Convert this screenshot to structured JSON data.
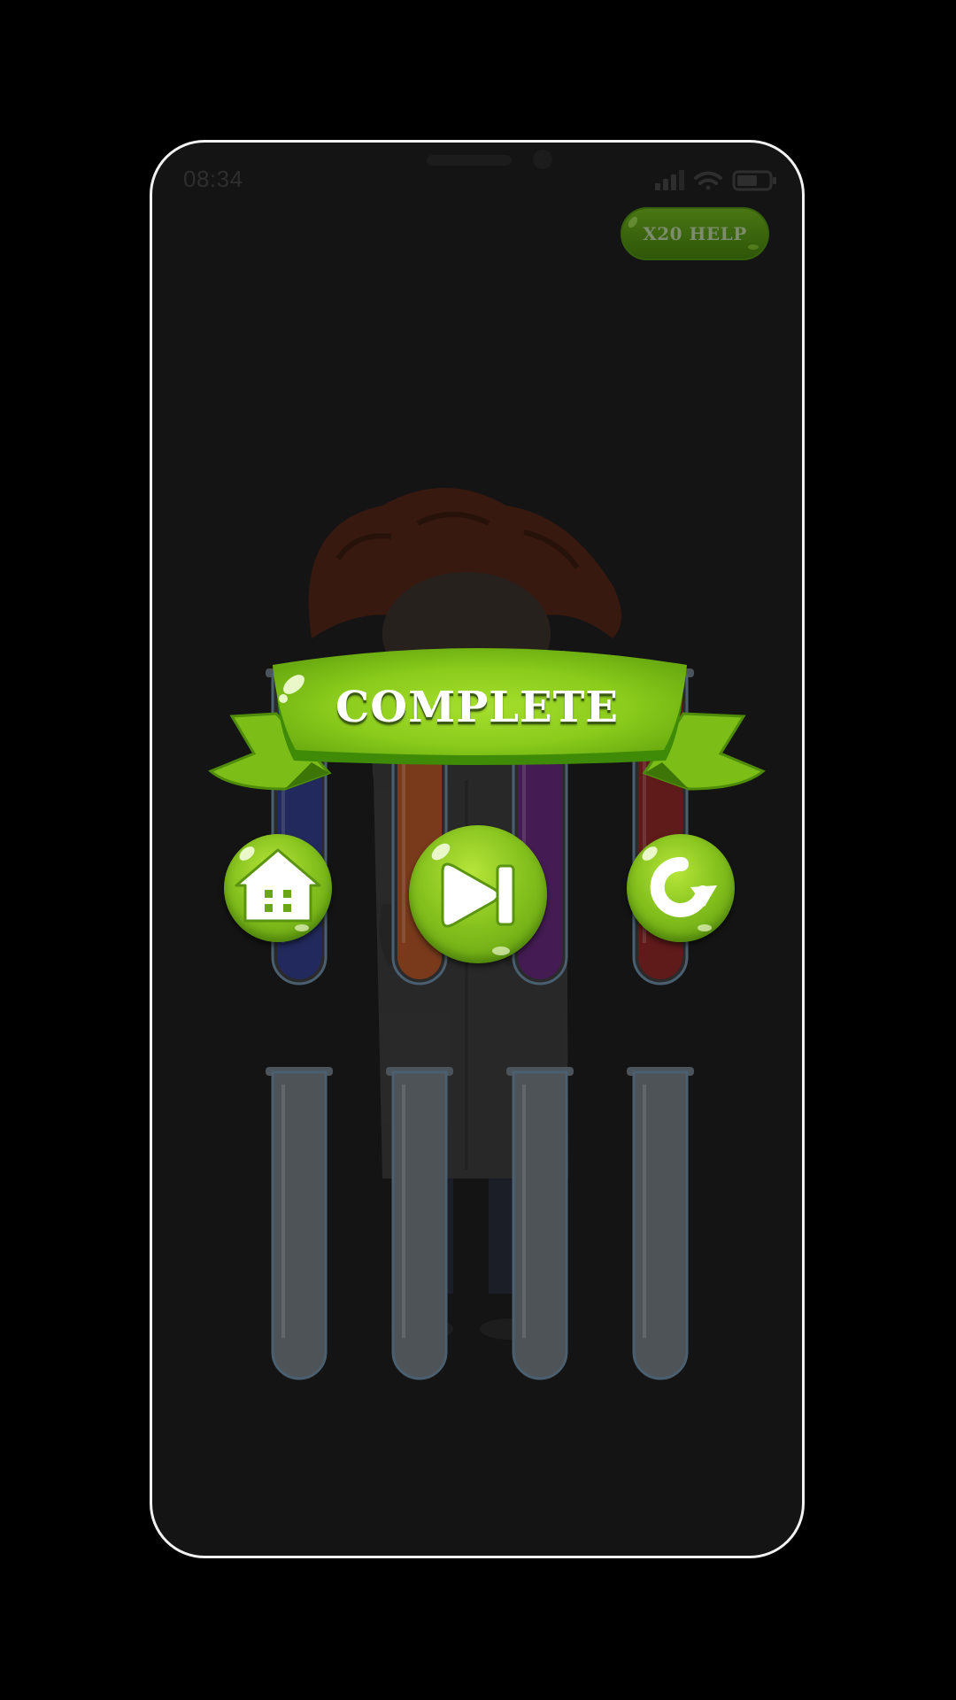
{
  "status_bar": {
    "time": "08:34"
  },
  "help_button": {
    "label": "X20 HELP"
  },
  "popup": {
    "title": "COMPLETE",
    "buttons": [
      {
        "name": "home",
        "icon": "home-icon"
      },
      {
        "name": "next-level",
        "icon": "skip-forward-icon"
      },
      {
        "name": "restart",
        "icon": "restart-icon"
      }
    ]
  },
  "tubes": {
    "top_row": [
      {
        "liquid_color": "#1c2a86"
      },
      {
        "liquid_color": "#b8470f"
      },
      {
        "liquid_color": "#5a1175"
      },
      {
        "liquid_color": "#8a0d0d"
      }
    ],
    "bottom_row": [
      {
        "liquid_color": ""
      },
      {
        "liquid_color": ""
      },
      {
        "liquid_color": ""
      },
      {
        "liquid_color": ""
      }
    ]
  },
  "colors": {
    "accent_green": "#86c21e",
    "background": "#141414",
    "frame": "#f2f2f2"
  }
}
